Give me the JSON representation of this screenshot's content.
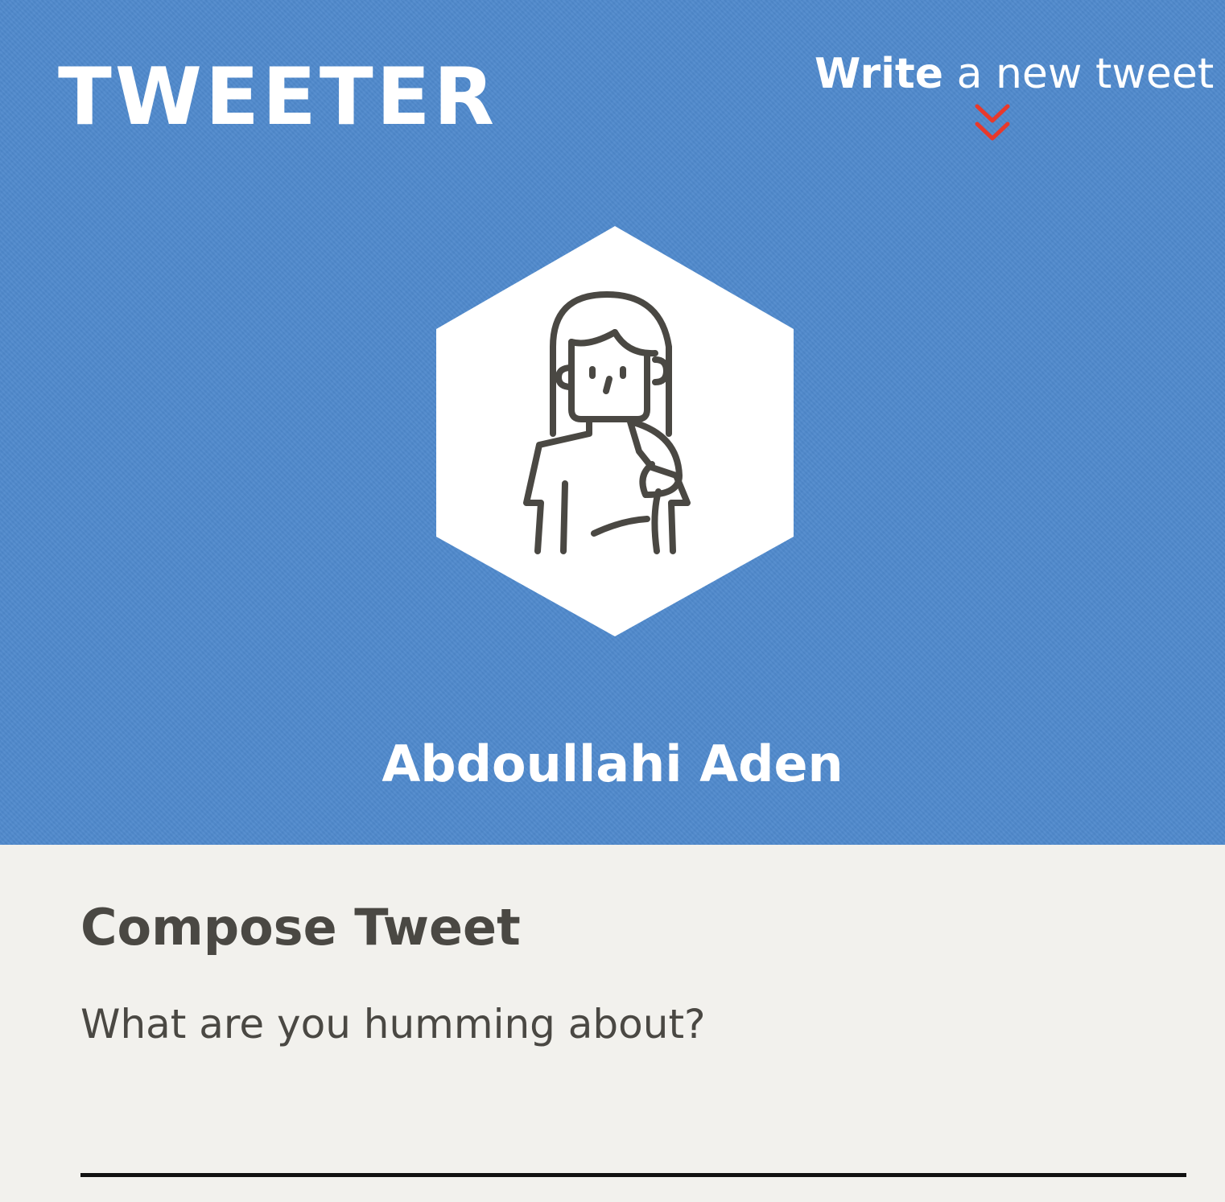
{
  "app": {
    "logo": "TWEETER"
  },
  "nav": {
    "write_strong": "Write",
    "write_rest": " a new tweet",
    "chevron_icon": "double-chevron-down-icon",
    "chevron_color": "#e8392c"
  },
  "profile": {
    "avatar_icon": "user-avatar-icon",
    "name": "Abdoullahi Aden"
  },
  "compose": {
    "title": "Compose Tweet",
    "input_value": "",
    "placeholder": "What are you humming about?"
  },
  "colors": {
    "header_bg": "#4f89cc",
    "panel_bg": "#f2f1ed",
    "text_dark": "#4a4843",
    "accent": "#e8392c"
  }
}
